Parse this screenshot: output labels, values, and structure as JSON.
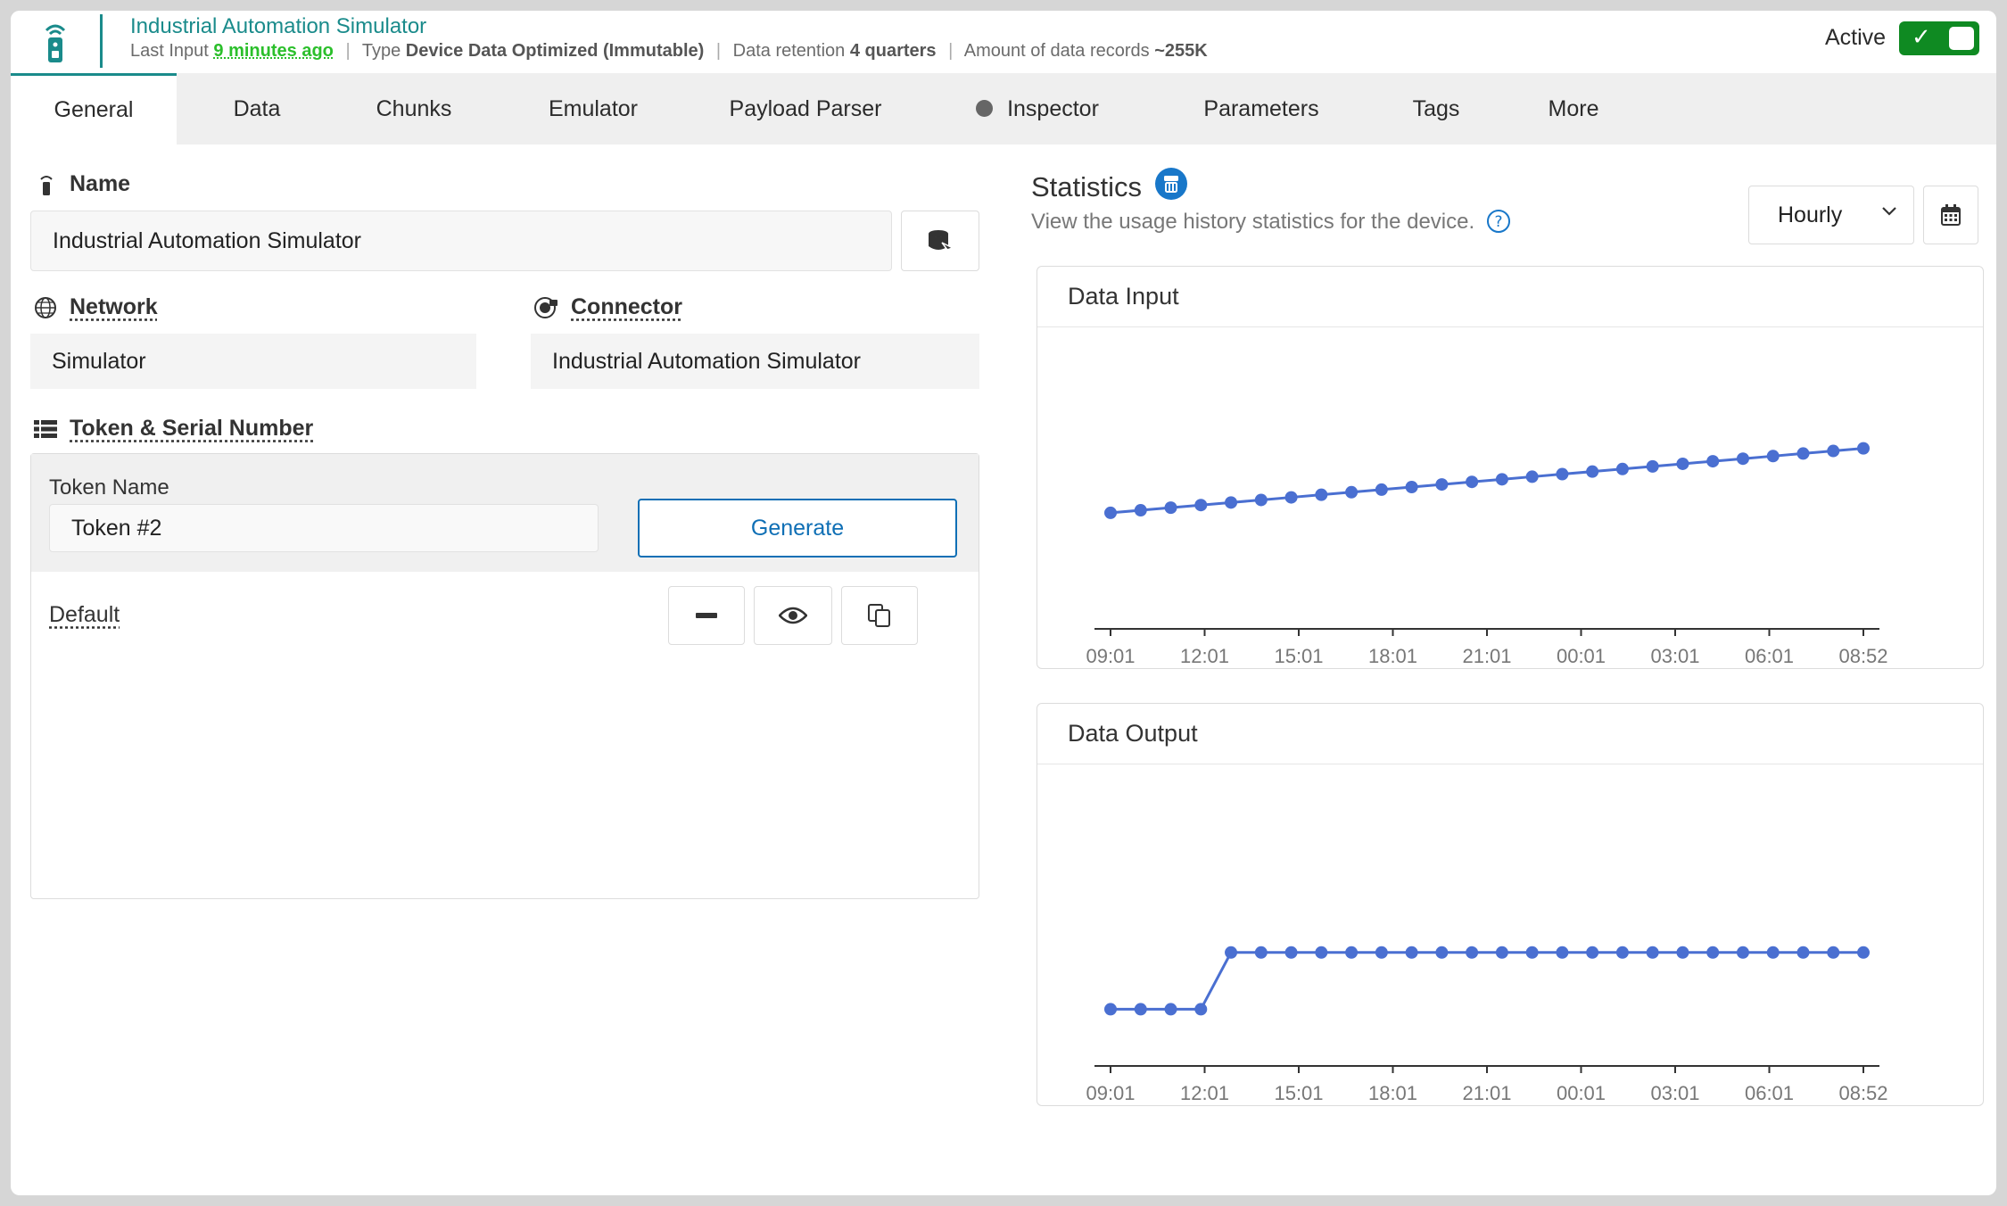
{
  "header": {
    "title": "Industrial Automation Simulator",
    "last_input_label": "Last Input",
    "last_input_value": "9 minutes ago",
    "type_label": "Type",
    "type_value": "Device Data Optimized (Immutable)",
    "retention_label": "Data retention",
    "retention_value": "4 quarters",
    "records_label": "Amount of data records",
    "records_value": "~255K",
    "active_label": "Active",
    "active": true
  },
  "tabs": [
    "General",
    "Data",
    "Chunks",
    "Emulator",
    "Payload Parser",
    "Inspector",
    "Parameters",
    "Tags",
    "More"
  ],
  "general": {
    "name_label": "Name",
    "name_value": "Industrial Automation Simulator",
    "network_label": "Network",
    "network_value": "Simulator",
    "connector_label": "Connector",
    "connector_value": "Industrial Automation Simulator",
    "token_section_label": "Token & Serial Number",
    "token_name_label": "Token Name",
    "token_name_value": "Token #2",
    "generate_label": "Generate",
    "default_label": "Default"
  },
  "statistics": {
    "title": "Statistics",
    "subtitle": "View the usage history statistics for the device.",
    "interval": "Hourly",
    "accent": "#4a6fd1"
  },
  "chart_data": [
    {
      "type": "line",
      "title": "Data Input",
      "x_ticks": [
        "09:01",
        "12:01",
        "15:01",
        "18:01",
        "21:01",
        "00:01",
        "03:01",
        "06:01",
        "08:52"
      ],
      "values": [
        0,
        0.04,
        0.08,
        0.12,
        0.16,
        0.2,
        0.24,
        0.28,
        0.32,
        0.36,
        0.4,
        0.44,
        0.48,
        0.52,
        0.56,
        0.6,
        0.64,
        0.68,
        0.72,
        0.76,
        0.8,
        0.84,
        0.88,
        0.92,
        0.96,
        1.0
      ],
      "ylim": [
        -1.8,
        2.6
      ],
      "grid": false,
      "legend": false
    },
    {
      "type": "line",
      "title": "Data Output",
      "x_ticks": [
        "09:01",
        "12:01",
        "15:01",
        "18:01",
        "21:01",
        "00:01",
        "03:01",
        "06:01",
        "08:52"
      ],
      "values": [
        0,
        0,
        0,
        0,
        1,
        1,
        1,
        1,
        1,
        1,
        1,
        1,
        1,
        1,
        1,
        1,
        1,
        1,
        1,
        1,
        1,
        1,
        1,
        1,
        1,
        1
      ],
      "ylim": [
        -1.0,
        4.0
      ],
      "grid": false,
      "legend": false
    }
  ]
}
